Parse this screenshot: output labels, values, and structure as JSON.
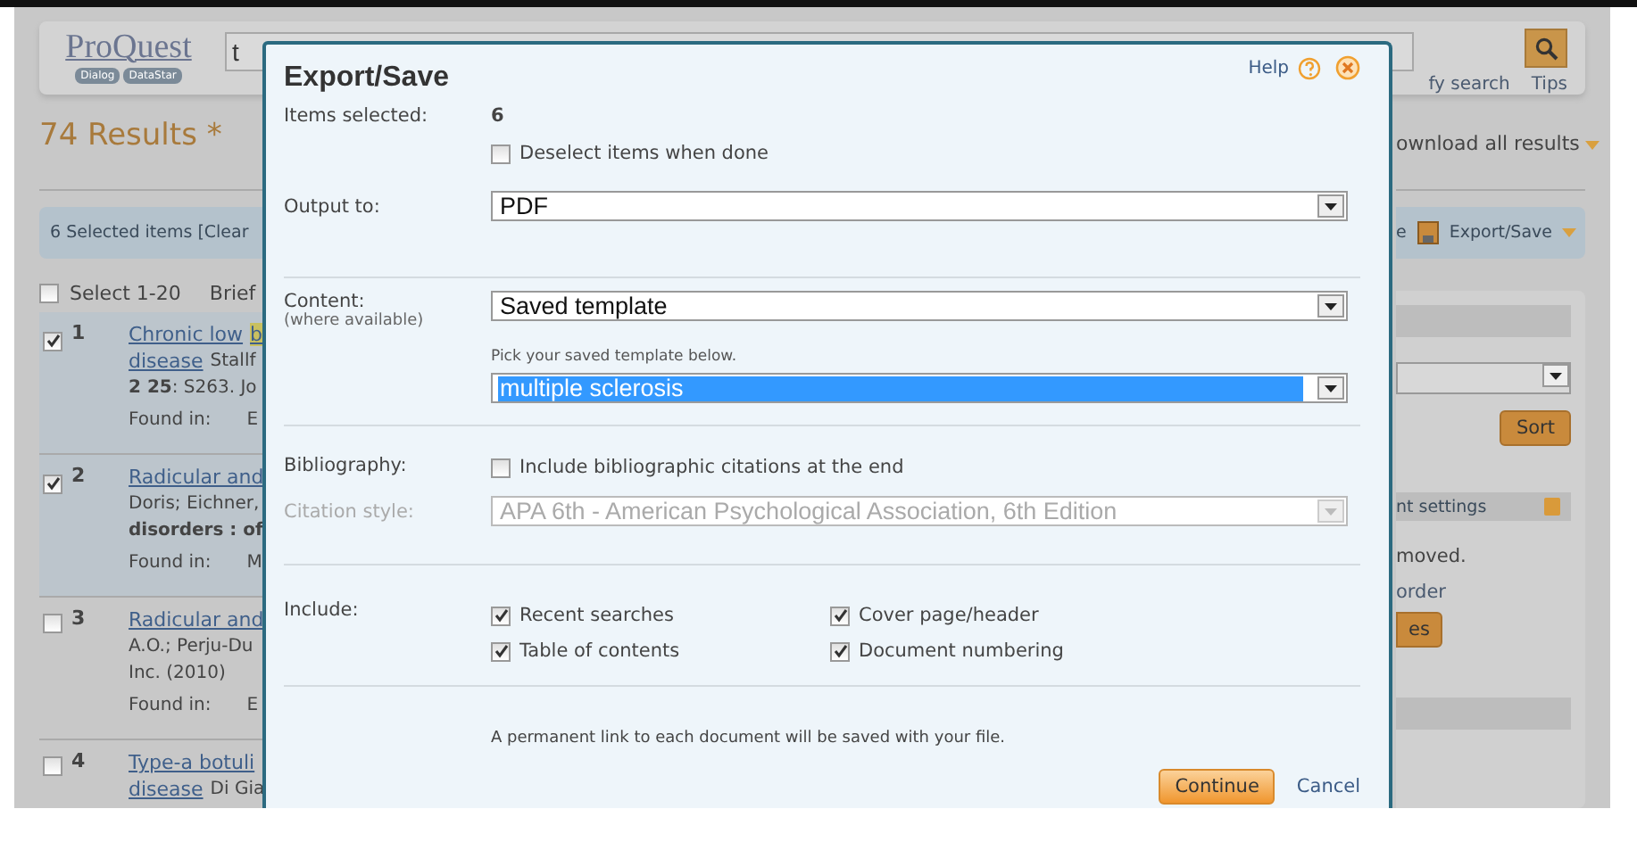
{
  "page": {
    "logo": {
      "name": "ProQuest",
      "tags": [
        "Dialog",
        "DataStar"
      ]
    },
    "search": {
      "value": "t"
    },
    "search_links": [
      "fy search",
      "Tips"
    ],
    "results_heading": "74 Results *",
    "download_link": "ownload all results",
    "selection_bar": {
      "text": "6 Selected items [Clear",
      "trailing": "e",
      "export": "Export/Save"
    },
    "select_all": {
      "label": "Select 1-20",
      "checked": false,
      "view": "Brief"
    },
    "results": [
      {
        "number": "1",
        "checked": true,
        "title": "Chronic low",
        "title_highlight": "b",
        "title_cont": "disease",
        "byline": "Stallf",
        "lines": [
          {
            "text": "**2 25**: S263. Jo",
            "bold": false
          }
        ],
        "found_in": "Found in:",
        "source": "E"
      },
      {
        "number": "2",
        "checked": true,
        "title": "Radicular and",
        "lines": [
          {
            "text": "Doris; Eichner,",
            "bold": false
          },
          {
            "text": "disorders : of",
            "bold": true
          }
        ],
        "found_in": "Found in:",
        "source": "M"
      },
      {
        "number": "3",
        "checked": false,
        "title": "Radicular and",
        "lines": [
          {
            "text": "A.O.; Perju-Du",
            "bold": false
          },
          {
            "text": "Inc. (2010)",
            "bold": false
          }
        ],
        "found_in": "Found in:",
        "source": "E"
      },
      {
        "number": "4",
        "checked": false,
        "title": "Type-a botuli",
        "title_cont": "disease",
        "byline": "Di Gia"
      }
    ],
    "side_panel": {
      "sort_button": "Sort",
      "settings_label": "nt settings",
      "note": "moved.",
      "order_link": "order",
      "button": "es"
    }
  },
  "dialog": {
    "title": "Export/Save",
    "help": "Help",
    "items_selected": {
      "label": "Items selected:",
      "value": "6"
    },
    "deselect": {
      "label": "Deselect items when done",
      "checked": false
    },
    "output": {
      "label": "Output to:",
      "value": "PDF"
    },
    "content": {
      "label": "Content:",
      "sublabel": "(where available)",
      "value": "Saved template",
      "hint": "Pick your saved template below.",
      "template": "multiple sclerosis",
      "template_selected": true
    },
    "bibliography": {
      "label": "Bibliography:",
      "option": "Include bibliographic citations at the end",
      "checked": false
    },
    "citation_style": {
      "label": "Citation style:",
      "value": "APA 6th - American Psychological Association, 6th Edition",
      "disabled": true
    },
    "include": {
      "label": "Include:",
      "options": [
        {
          "label": "Recent searches",
          "checked": true
        },
        {
          "label": "Cover page/header",
          "checked": true
        },
        {
          "label": "Table of contents",
          "checked": true
        },
        {
          "label": "Document numbering",
          "checked": true
        }
      ]
    },
    "note": "A permanent link to each document will be saved with your file.",
    "buttons": {
      "continue": "Continue",
      "cancel": "Cancel"
    }
  }
}
